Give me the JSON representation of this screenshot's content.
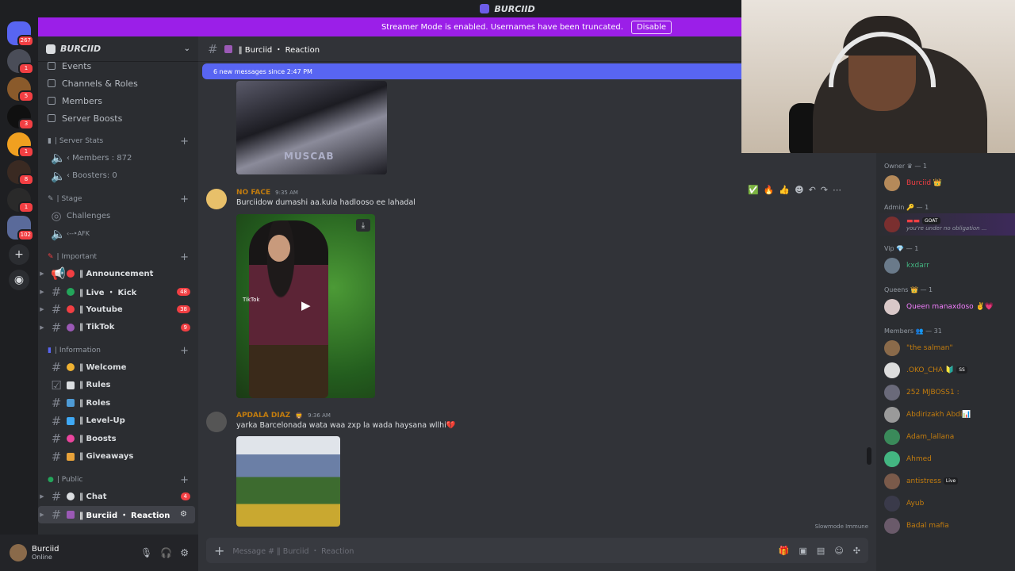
{
  "window": {
    "title": "BURCIID"
  },
  "banner": {
    "text": "Streamer Mode is enabled. Usernames have been truncated.",
    "button": "Disable"
  },
  "rail": {
    "mention_count": "267",
    "badges": [
      "1",
      "5",
      "3",
      "1",
      "8",
      "1",
      "102"
    ]
  },
  "server": {
    "name": "BURCIID"
  },
  "nav": [
    "Events",
    "Channels & Roles",
    "Members",
    "Server Boosts"
  ],
  "categories": {
    "stats": "| Server Stats",
    "stage": "| Stage",
    "important": "| Important",
    "information": "| Information",
    "public": "| Public"
  },
  "stats": {
    "members": "‹ Members : 872",
    "boosters": "‹ Boosters: 0"
  },
  "stage": {
    "challenges": "Challenges",
    "afk": "‹--‣AFK"
  },
  "channels": {
    "announcement": "‖ Announcement",
    "live": "‖ Live ・ Kick",
    "live_badge": "48",
    "youtube": "‖ Youtube",
    "youtube_badge": "38",
    "tiktok": "‖ TikTok",
    "tiktok_badge": "9",
    "welcome": "‖ Welcome",
    "rules": "‖ Rules",
    "roles": "‖ Roles",
    "levelup": "‖ Level-Up",
    "boosts": "‖ Boosts",
    "giveaways": "‖ Giveaways",
    "chat": "‖ Chat",
    "chat_badge": "4",
    "reaction": "‖ Burciid ・ Reaction"
  },
  "user": {
    "name": "Burciid",
    "status": "Online"
  },
  "header": {
    "channel": "‖ Burciid ・ Reaction"
  },
  "new_messages": "6 new messages since 2:47 PM",
  "image1_watermark": "MUSCAB",
  "messages": [
    {
      "author": "NO FACE",
      "time": "9:35 AM",
      "text": "Burciidow  dumashi aa.kula hadlooso ee lahadal",
      "author_color": "#c27c0e"
    },
    {
      "author": "APDALA DIAZ",
      "time": "9:36 AM",
      "text": "yarka Barcelonada wata waa zxp la wada haysana wllhi💔",
      "author_color": "#c27c0e"
    }
  ],
  "video": {
    "watermark": "TikTok"
  },
  "hover_tools": [
    "✅",
    "🔥",
    "👍",
    "☻",
    "↶",
    "↷",
    "⋯"
  ],
  "slowmode": "Slowmode Immune",
  "composer": {
    "placeholder": "Message # ‖ Burciid ・ Reaction"
  },
  "member_list": {
    "owner_cat": "Owner ♛ — 1",
    "owner": "Burciid 👑",
    "admin_cat": "Admin 🔑 — 1",
    "admin_tag": "GOAT",
    "admin_status": "you're under no obligation ...",
    "vip_cat": "Vip 💎 — 1",
    "vip": "kxdarr",
    "queens_cat": "Queens 👑 — 1",
    "queen": "Queen manaxdoso ✌️💗",
    "members_cat": "Members 👥 — 31",
    "members": [
      {
        "name": "\"the salman\"",
        "color": "#c27c0e"
      },
      {
        "name": ".OKO_CHA 🔰",
        "color": "#c27c0e",
        "tag": "SS"
      },
      {
        "name": "252 MJBOSS1 :",
        "color": "#c27c0e"
      },
      {
        "name": "Abdirizakh Abdi📊",
        "color": "#c27c0e"
      },
      {
        "name": "Adam_lallana",
        "color": "#c27c0e"
      },
      {
        "name": "Ahmed",
        "color": "#c27c0e"
      },
      {
        "name": "antistress",
        "color": "#c27c0e",
        "tag": "Live"
      },
      {
        "name": "Ayub",
        "color": "#c27c0e"
      },
      {
        "name": "Badal mafia",
        "color": "#c27c0e"
      }
    ]
  },
  "colors": {
    "accent": "#5865f2",
    "banner": "#9b1fe8",
    "badge": "#f23f43",
    "owner": "#f23f43",
    "vip": "#43b581",
    "queen": "#f47fff"
  }
}
